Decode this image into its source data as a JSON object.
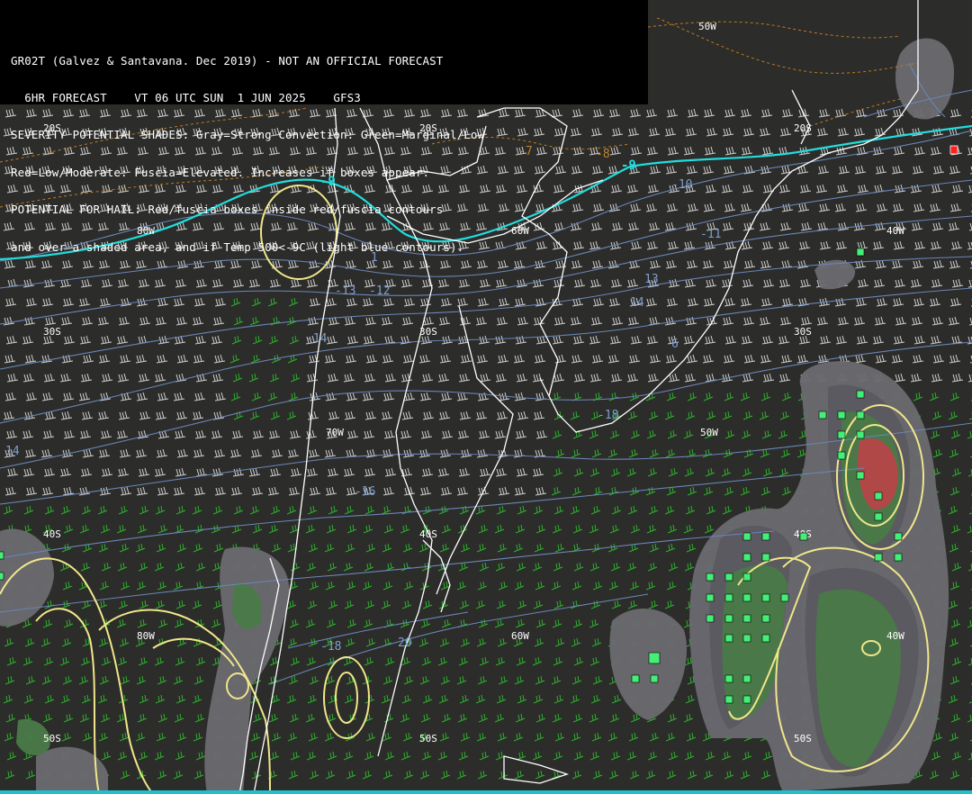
{
  "header": {
    "line1": "GR02T (Galvez & Santavana. Dec 2019) - NOT AN OFFICIAL FORECAST",
    "line2": "  6HR FORECAST    VT 06 UTC SUN  1 JUN 2025    GFS3",
    "line3": "SEVERITY POTENTIAL SHADES: Gray=Strong Convection: Green=Marginal/Low",
    "line4": "Red=Low/Moderate: Fuscia=Elevated. Increases if boxes appear.",
    "line5": "POTENTIAL FOR HAIL: Red/fuscia boxes inside red/fuscia contours",
    "line6": "and over a shaded area, and if Temp 500<-9C (light blue contours)."
  },
  "grid_labels": {
    "lon_80w_a": "80W",
    "lon_70w_a": "70W",
    "lon_60w_a": "60W",
    "lon_50w_a": "50W",
    "lon_40w_a": "40W",
    "lon_80w_b": "80W",
    "lon_60w_b": "60W",
    "lon_50w_b": "50W",
    "lon_40w_b": "40W",
    "lat_20s_a": "20S",
    "lat_20s_b": "20S",
    "lat_20s_c": "20S",
    "lat_30s_a": "30S",
    "lat_30s_b": "30S",
    "lat_30s_c": "30S",
    "lat_40s_a": "40S",
    "lat_40s_b": "40S",
    "lat_40s_c": "40S",
    "lat_50s_a": "50S",
    "lat_50s_b": "50S",
    "lat_50s_c": "50S"
  },
  "temp_labels": {
    "t_m9_a": "-9",
    "t_m9_b": "-9",
    "t_m7": "-7",
    "t_m8": "-8",
    "t_m10": "-10",
    "t_m11": "-11",
    "t_m11_w": "11",
    "t_m13_w": "-13",
    "t_m12": "-12",
    "t_13": "13",
    "t_14": "14",
    "t_m14": "-14",
    "t_m6": "6",
    "t_m18": "-18",
    "t_m16": "-16",
    "t_14_w": "14",
    "t_m18_s": "-18",
    "t_20": "20",
    "t_m11_n": "1"
  },
  "colors": {
    "background": "#2c2c2a",
    "coast": "#ffffff",
    "temp_contour": "#6a86b8",
    "minus9_contour": "#22dddd",
    "orange_contour": "#c07a20",
    "yellow_contour": "#f0e68a",
    "gray_shade": "#6a6a70",
    "green_shade": "#4a7a48",
    "red_shade": "#b04848",
    "box_green": "#44ee77",
    "box_red": "#ff2020",
    "wind_green": "#22bb22",
    "wind_white": "#d8d8d8"
  }
}
